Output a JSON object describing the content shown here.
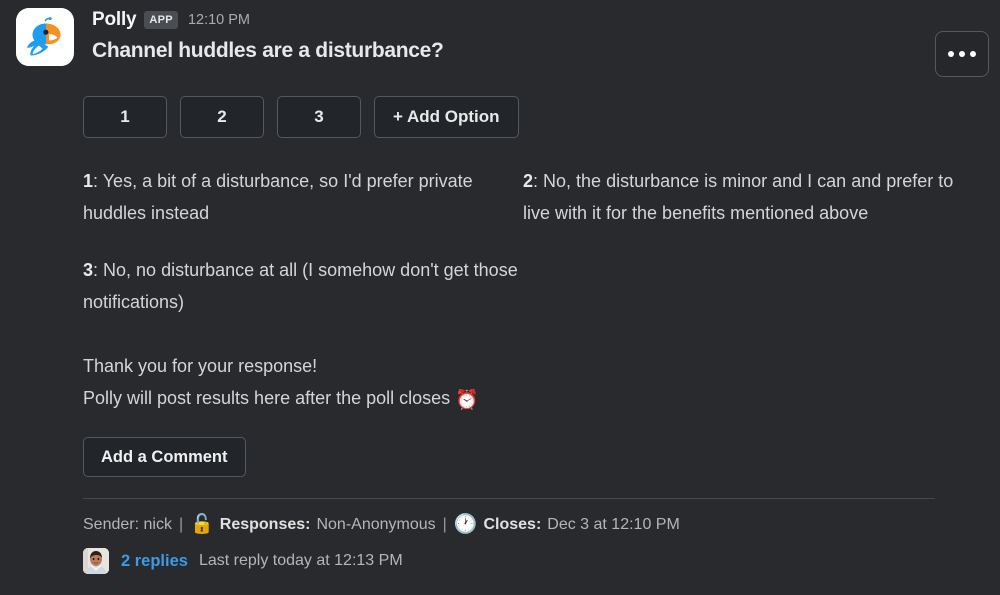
{
  "message": {
    "app_name": "Polly",
    "app_badge": "APP",
    "timestamp": "12:10 PM",
    "poll_title": "Channel huddles are a disturbance?",
    "avatar_icon": "polly-parrot-logo",
    "overflow_icon": "more-actions-icon"
  },
  "poll": {
    "option_buttons": [
      {
        "label": "1"
      },
      {
        "label": "2"
      },
      {
        "label": "3"
      },
      {
        "label": "+ Add Option"
      }
    ],
    "options": [
      {
        "num": "1",
        "sep": ": ",
        "text": "Yes, a bit of a disturbance, so I'd prefer private huddles instead"
      },
      {
        "num": "2",
        "sep": ": ",
        "text": "No, the disturbance is minor and I can and prefer to live with it for the benefits mentioned above"
      },
      {
        "num": "3",
        "sep": ": ",
        "text": "No, no disturbance at all (I somehow don't get those notifications)"
      }
    ],
    "thank_you": "Thank you for your response!",
    "results_note": "Polly will post results here after the poll closes",
    "results_emoji": "⏰",
    "results_emoji_name": "alarm-clock-emoji",
    "comment_button": "Add a Comment"
  },
  "meta": {
    "sender_label": "Sender: nick",
    "separator": "|",
    "lock_emoji": "🔓",
    "lock_emoji_name": "unlocked-padlock-emoji",
    "responses_label": "Responses:",
    "responses_value": "Non-Anonymous",
    "clock_emoji": "🕐",
    "clock_emoji_name": "clock-emoji",
    "closes_label": "Closes:",
    "closes_value": "Dec 3 at 12:10 PM"
  },
  "thread": {
    "avatar_name": "user-avatar",
    "replies_count": "2 replies",
    "last_reply": "Last reply today at 12:13 PM"
  },
  "colors": {
    "background": "#282a2d",
    "link": "#3c9ae8",
    "button_border": "#55585c",
    "button_fill": "#222529",
    "text": "#d4d5d6"
  }
}
